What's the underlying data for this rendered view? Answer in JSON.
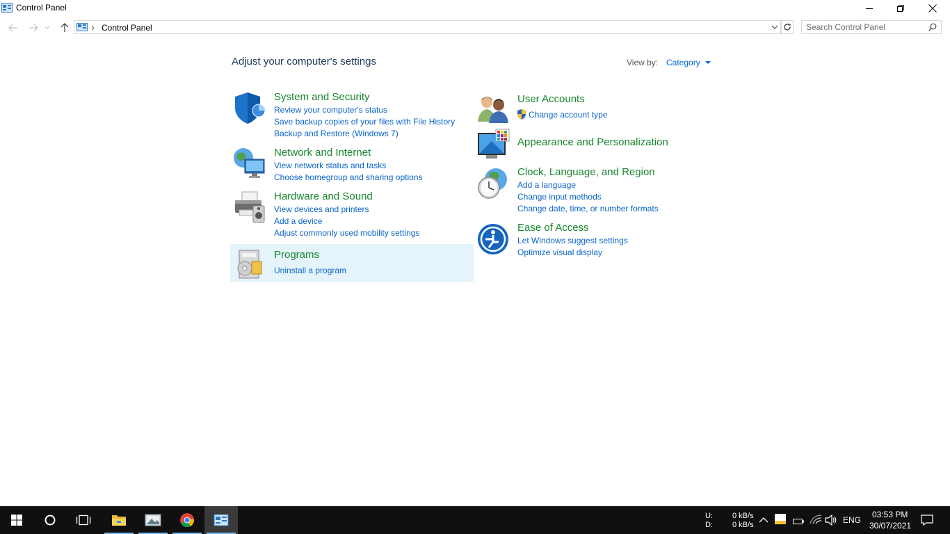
{
  "window": {
    "title": "Control Panel",
    "controls": {
      "minimize": "minimize-icon",
      "restore": "restore-icon",
      "close": "close-icon"
    }
  },
  "address_bar": {
    "path": "Control Panel",
    "search_placeholder": "Search Control Panel"
  },
  "content": {
    "title": "Adjust your computer's settings",
    "view_by_label": "View by:",
    "view_by_value": "Category",
    "left_categories": [
      {
        "title": "System and Security",
        "icon": "shield-icon",
        "links": [
          "Review your computer's status",
          "Save backup copies of your files with File History",
          "Backup and Restore (Windows 7)"
        ]
      },
      {
        "title": "Network and Internet",
        "icon": "network-globe-icon",
        "links": [
          "View network status and tasks",
          "Choose homegroup and sharing options"
        ]
      },
      {
        "title": "Hardware and Sound",
        "icon": "printer-speaker-icon",
        "links": [
          "View devices and printers",
          "Add a device",
          "Adjust commonly used mobility settings"
        ]
      },
      {
        "title": "Programs",
        "icon": "programs-disc-icon",
        "links": [
          "Uninstall a program"
        ]
      }
    ],
    "right_categories": [
      {
        "title": "User Accounts",
        "icon": "users-icon",
        "links": [
          "Change account type"
        ]
      },
      {
        "title": "Appearance and Personalization",
        "icon": "monitor-palette-icon",
        "links": []
      },
      {
        "title": "Clock, Language, and Region",
        "icon": "clock-globe-icon",
        "links": [
          "Add a language",
          "Change input methods",
          "Change date, time, or number formats"
        ]
      },
      {
        "title": "Ease of Access",
        "icon": "ease-of-access-icon",
        "links": [
          "Let Windows suggest settings",
          "Optimize visual display"
        ]
      }
    ]
  },
  "taskbar": {
    "net_up_label": "U:",
    "net_down_label": "D:",
    "net_up": "0 kB/s",
    "net_down": "0 kB/s",
    "language": "ENG",
    "time": "03:53 PM",
    "date": "30/07/2021",
    "accent_color": "#76b9ed"
  }
}
